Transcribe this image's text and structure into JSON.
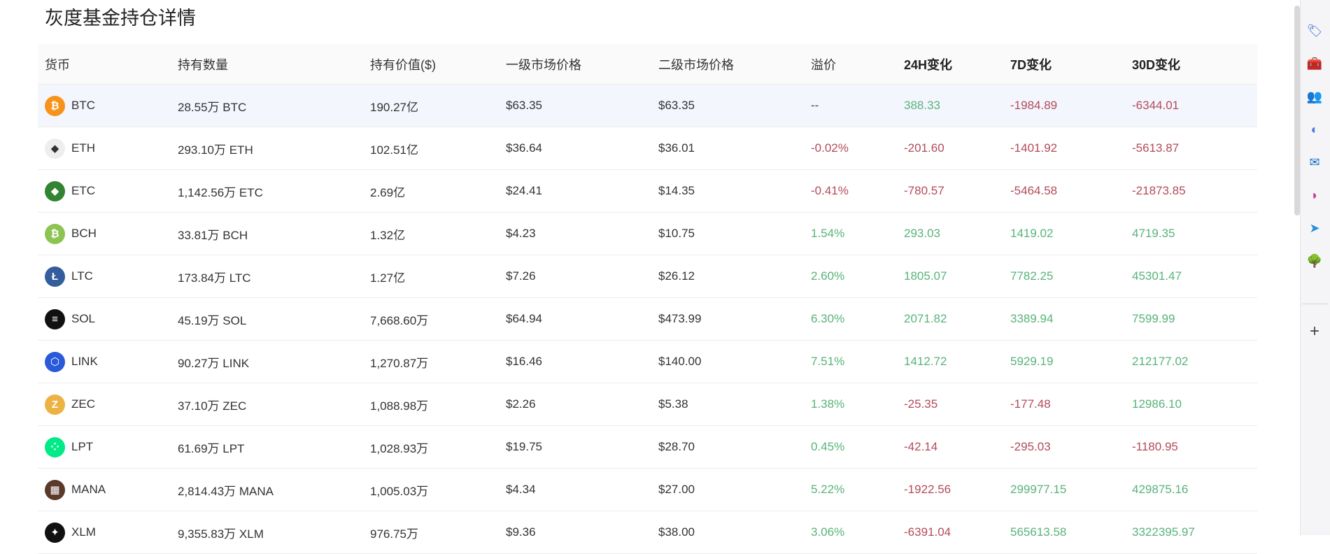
{
  "page": {
    "title": "灰度基金持仓详情"
  },
  "table": {
    "headers": [
      "货币",
      "持有数量",
      "持有价值($)",
      "一级市场价格",
      "二级市场价格",
      "溢价",
      "24H变化",
      "7D变化",
      "30D变化"
    ],
    "rows": [
      {
        "coin": "BTC",
        "icon_color": "#f7931a",
        "icon_glyph": "₿",
        "amount": "28.55万 BTC",
        "value": "190.27亿",
        "primary": "$63.35",
        "secondary": "$63.35",
        "premium": "--",
        "premium_tone": "neutral",
        "h24": "388.33",
        "h24_tone": "pos",
        "d7": "-1984.89",
        "d7_tone": "neg",
        "d30": "-6344.01",
        "d30_tone": "neg"
      },
      {
        "coin": "ETH",
        "icon_color": "#eeeeee",
        "icon_glyph": "◆",
        "amount": "293.10万 ETH",
        "value": "102.51亿",
        "primary": "$36.64",
        "secondary": "$36.01",
        "premium": "-0.02%",
        "premium_tone": "neg",
        "h24": "-201.60",
        "h24_tone": "neg",
        "d7": "-1401.92",
        "d7_tone": "neg",
        "d30": "-5613.87",
        "d30_tone": "neg"
      },
      {
        "coin": "ETC",
        "icon_color": "#328332",
        "icon_glyph": "◆",
        "amount": "1,142.56万 ETC",
        "value": "2.69亿",
        "primary": "$24.41",
        "secondary": "$14.35",
        "premium": "-0.41%",
        "premium_tone": "neg",
        "h24": "-780.57",
        "h24_tone": "neg",
        "d7": "-5464.58",
        "d7_tone": "neg",
        "d30": "-21873.85",
        "d30_tone": "neg"
      },
      {
        "coin": "BCH",
        "icon_color": "#8dc351",
        "icon_glyph": "₿",
        "amount": "33.81万 BCH",
        "value": "1.32亿",
        "primary": "$4.23",
        "secondary": "$10.75",
        "premium": "1.54%",
        "premium_tone": "pos",
        "h24": "293.03",
        "h24_tone": "pos",
        "d7": "1419.02",
        "d7_tone": "pos",
        "d30": "4719.35",
        "d30_tone": "pos"
      },
      {
        "coin": "LTC",
        "icon_color": "#345d9d",
        "icon_glyph": "Ł",
        "amount": "173.84万 LTC",
        "value": "1.27亿",
        "primary": "$7.26",
        "secondary": "$26.12",
        "premium": "2.60%",
        "premium_tone": "pos",
        "h24": "1805.07",
        "h24_tone": "pos",
        "d7": "7782.25",
        "d7_tone": "pos",
        "d30": "45301.47",
        "d30_tone": "pos"
      },
      {
        "coin": "SOL",
        "icon_color": "#111111",
        "icon_glyph": "≡",
        "amount": "45.19万 SOL",
        "value": "7,668.60万",
        "primary": "$64.94",
        "secondary": "$473.99",
        "premium": "6.30%",
        "premium_tone": "pos",
        "h24": "2071.82",
        "h24_tone": "pos",
        "d7": "3389.94",
        "d7_tone": "pos",
        "d30": "7599.99",
        "d30_tone": "pos"
      },
      {
        "coin": "LINK",
        "icon_color": "#2a5ada",
        "icon_glyph": "⬡",
        "amount": "90.27万 LINK",
        "value": "1,270.87万",
        "primary": "$16.46",
        "secondary": "$140.00",
        "premium": "7.51%",
        "premium_tone": "pos",
        "h24": "1412.72",
        "h24_tone": "pos",
        "d7": "5929.19",
        "d7_tone": "pos",
        "d30": "212177.02",
        "d30_tone": "pos"
      },
      {
        "coin": "ZEC",
        "icon_color": "#ecb244",
        "icon_glyph": "Z",
        "amount": "37.10万 ZEC",
        "value": "1,088.98万",
        "primary": "$2.26",
        "secondary": "$5.38",
        "premium": "1.38%",
        "premium_tone": "pos",
        "h24": "-25.35",
        "h24_tone": "neg",
        "d7": "-177.48",
        "d7_tone": "neg",
        "d30": "12986.10",
        "d30_tone": "pos"
      },
      {
        "coin": "LPT",
        "icon_color": "#00eb88",
        "icon_glyph": "⁘",
        "amount": "61.69万 LPT",
        "value": "1,028.93万",
        "primary": "$19.75",
        "secondary": "$28.70",
        "premium": "0.45%",
        "premium_tone": "pos",
        "h24": "-42.14",
        "h24_tone": "neg",
        "d7": "-295.03",
        "d7_tone": "neg",
        "d30": "-1180.95",
        "d30_tone": "neg"
      },
      {
        "coin": "MANA",
        "icon_color": "#5a3a2a",
        "icon_glyph": "▦",
        "amount": "2,814.43万 MANA",
        "value": "1,005.03万",
        "primary": "$4.34",
        "secondary": "$27.00",
        "premium": "5.22%",
        "premium_tone": "pos",
        "h24": "-1922.56",
        "h24_tone": "neg",
        "d7": "299977.15",
        "d7_tone": "pos",
        "d30": "429875.16",
        "d30_tone": "pos"
      },
      {
        "coin": "XLM",
        "icon_color": "#111111",
        "icon_glyph": "✦",
        "amount": "9,355.83万 XLM",
        "value": "976.75万",
        "primary": "$9.36",
        "secondary": "$38.00",
        "premium": "3.06%",
        "premium_tone": "pos",
        "h24": "-6391.04",
        "h24_tone": "neg",
        "d7": "565613.58",
        "d7_tone": "pos",
        "d30": "3322395.97",
        "d30_tone": "pos"
      }
    ]
  },
  "colors": {
    "positive": "#58b37a",
    "negative": "#b24b5a",
    "highlight_row": "#f3f6fd"
  },
  "sidebar": {
    "icons": [
      {
        "name": "tag-icon",
        "glyph": "🏷",
        "color": "#3b6fd8"
      },
      {
        "name": "toolbox-icon",
        "glyph": "🧰",
        "color": "#d85a2a"
      },
      {
        "name": "people-icon",
        "glyph": "👥",
        "color": "#7b6aa8"
      },
      {
        "name": "copilot-icon",
        "glyph": "◐",
        "color": "#4b7bd8"
      },
      {
        "name": "outlook-icon",
        "glyph": "✉",
        "color": "#1a73c8"
      },
      {
        "name": "games-icon",
        "glyph": "◗",
        "color": "#c83a9a"
      },
      {
        "name": "send-icon",
        "glyph": "➤",
        "color": "#2a8fd8"
      },
      {
        "name": "tree-icon",
        "glyph": "🌳",
        "color": "#3a9a3a"
      }
    ],
    "add_glyph": "+"
  }
}
